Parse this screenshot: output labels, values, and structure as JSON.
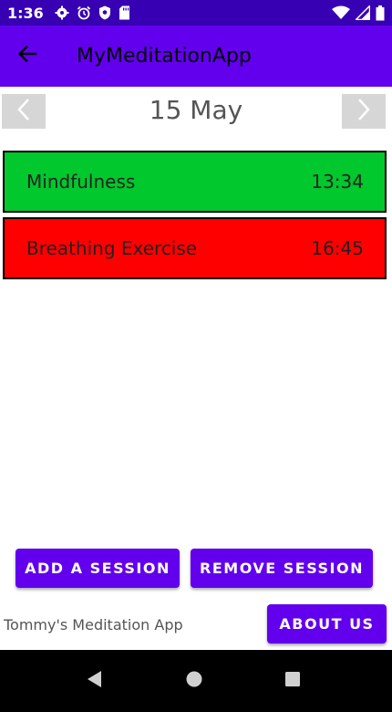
{
  "status_bar": {
    "time": "1:36",
    "icons_left": [
      "gear-icon",
      "alarm-icon",
      "shield-icon",
      "sd-card-icon"
    ],
    "icons_right": [
      "wifi-icon",
      "signal-icon",
      "battery-icon"
    ],
    "color": "#3700b3"
  },
  "app_bar": {
    "title": "MyMeditationApp",
    "back_icon": "arrow-back-icon",
    "color": "#6200ee"
  },
  "date_nav": {
    "date": "15 May",
    "prev_icon": "chevron-left-icon",
    "next_icon": "chevron-right-icon"
  },
  "sessions": [
    {
      "name": "Mindfulness",
      "time": "13:34",
      "color": "#00c82d"
    },
    {
      "name": "Breathing Exercise",
      "time": "16:45",
      "color": "#ff0000"
    }
  ],
  "actions": {
    "add_label": "ADD A SESSION",
    "remove_label": "REMOVE SESSION",
    "about_label": "ABOUT US"
  },
  "footer": {
    "text": "Tommy's Meditation App"
  },
  "system_nav": {
    "icons": [
      "back-triangle-icon",
      "home-circle-icon",
      "recents-square-icon"
    ]
  }
}
